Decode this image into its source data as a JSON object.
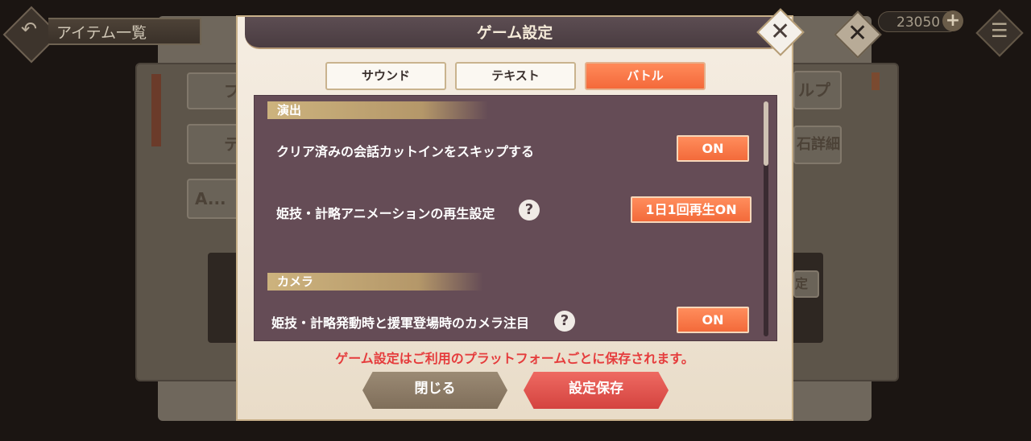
{
  "background": {
    "title": "アイテム一覧",
    "currency_value": "23050",
    "currency_plus": "+",
    "close_glyph": "✕",
    "menu_glyph": "☰",
    "back_glyph": "↶",
    "tiles": [
      {
        "text": "プ"
      },
      {
        "text": "テ"
      },
      {
        "text": "A..."
      },
      {
        "text": "ルプ"
      },
      {
        "text": "石詳細"
      },
      {
        "text": "定"
      }
    ]
  },
  "dialog": {
    "title": "ゲーム設定",
    "close_glyph": "✕",
    "tabs": [
      {
        "label": "サウンド",
        "active": false
      },
      {
        "label": "テキスト",
        "active": false
      },
      {
        "label": "バトル",
        "active": true
      }
    ],
    "sections": [
      {
        "heading": "演出",
        "rows": [
          {
            "label": "クリア済みの会話カットインをスキップする",
            "value": "ON",
            "help": false
          },
          {
            "label": "姫技・計略アニメーションの再生設定",
            "value": "1日1回再生ON",
            "help": true
          }
        ]
      },
      {
        "heading": "カメラ",
        "rows": [
          {
            "label": "姫技・計略発動時と援軍登場時のカメラ注目",
            "value": "ON",
            "help": true
          }
        ]
      }
    ],
    "help_glyph": "?",
    "notice": "ゲーム設定はご利用のプラットフォームごとに保存されます。",
    "buttons": {
      "close": "閉じる",
      "save": "設定保存"
    }
  }
}
